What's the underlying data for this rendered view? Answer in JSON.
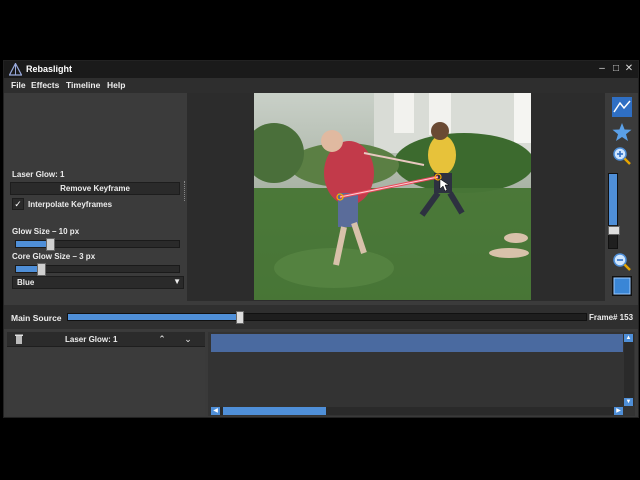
{
  "window": {
    "title": "Rebaslight",
    "controls": [
      "minimize-icon",
      "maximize-icon",
      "close-icon"
    ]
  },
  "menu": {
    "items": [
      "File",
      "Effects",
      "Timeline",
      "Help"
    ]
  },
  "left_panel": {
    "effect_title": "Laser Glow: 1",
    "remove_keyframe_label": "Remove Keyframe",
    "interpolate_label": "Interpolate Keyframes",
    "interpolate_checked": true,
    "glow_size_label": "Glow Size – 10 px",
    "glow_size_fraction": 0.2,
    "core_glow_label": "Core Glow Size – 3 px",
    "core_glow_fraction": 0.15,
    "color_selected": "Blue"
  },
  "preview": {
    "laser_color": "#e8495b"
  },
  "right_tools": {
    "icons": [
      "mountain-icon",
      "star-icon",
      "zoom-in-icon",
      "zoom-out-icon",
      "fit-frame-icon"
    ],
    "zoom_fraction": 0.2
  },
  "source_bar": {
    "label": "Main Source",
    "progress_fraction": 0.33,
    "frame_label": "Frame# 153"
  },
  "timeline": {
    "layer_name": "Laser Glow: 1",
    "icons": [
      "trash-icon",
      "move-up-icon",
      "move-down-icon"
    ]
  },
  "colors": {
    "accent": "#4f8fd8",
    "panel": "#3b3b3b",
    "titlebar": "#1a1a1a"
  }
}
